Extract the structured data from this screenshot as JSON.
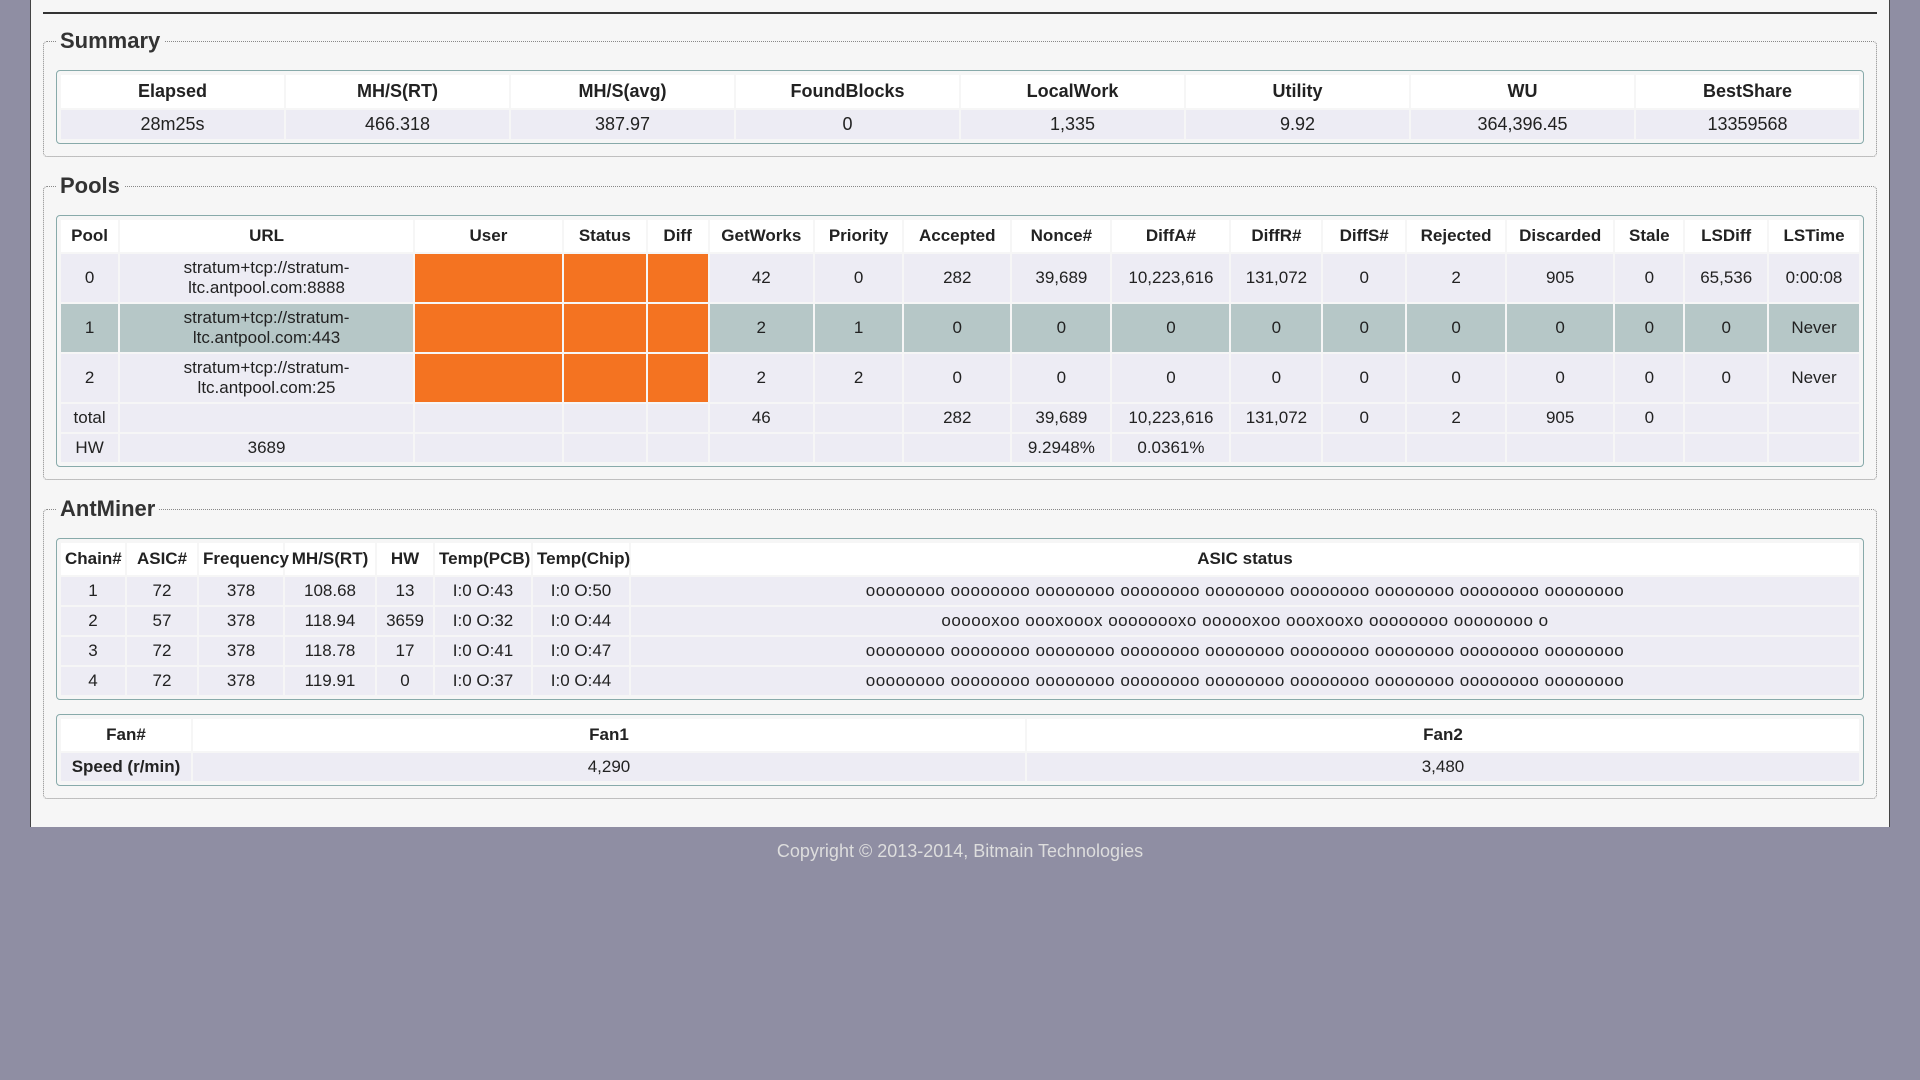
{
  "summary": {
    "legend": "Summary",
    "headers": [
      "Elapsed",
      "MH/S(RT)",
      "MH/S(avg)",
      "FoundBlocks",
      "LocalWork",
      "Utility",
      "WU",
      "BestShare"
    ],
    "row": [
      "28m25s",
      "466.318",
      "387.97",
      "0",
      "1,335",
      "9.92",
      "364,396.45",
      "13359568"
    ]
  },
  "pools": {
    "legend": "Pools",
    "headers": [
      "Pool",
      "URL",
      "User",
      "Status",
      "Diff",
      "GetWorks",
      "Priority",
      "Accepted",
      "Nonce#",
      "DiffA#",
      "DiffR#",
      "DiffS#",
      "Rejected",
      "Discarded",
      "Stale",
      "LSDiff",
      "LSTime"
    ],
    "rows": [
      {
        "highlight": false,
        "cells": [
          "0",
          "stratum+tcp://stratum-ltc.antpool.com:8888",
          "",
          "",
          "",
          "42",
          "0",
          "282",
          "39,689",
          "10,223,616",
          "131,072",
          "0",
          "2",
          "905",
          "0",
          "65,536",
          "0:00:08"
        ],
        "redact": [
          2,
          3,
          4
        ]
      },
      {
        "highlight": true,
        "cells": [
          "1",
          "stratum+tcp://stratum-ltc.antpool.com:443",
          "",
          "",
          "",
          "2",
          "1",
          "0",
          "0",
          "0",
          "0",
          "0",
          "0",
          "0",
          "0",
          "0",
          "Never"
        ],
        "redact": [
          2,
          3,
          4
        ]
      },
      {
        "highlight": false,
        "cells": [
          "2",
          "stratum+tcp://stratum-ltc.antpool.com:25",
          "",
          "",
          "",
          "2",
          "2",
          "0",
          "0",
          "0",
          "0",
          "0",
          "0",
          "0",
          "0",
          "0",
          "Never"
        ],
        "redact": [
          2,
          3,
          4
        ]
      },
      {
        "highlight": false,
        "cells": [
          "total",
          "",
          "",
          "",
          "",
          "46",
          "",
          "282",
          "39,689",
          "10,223,616",
          "131,072",
          "0",
          "2",
          "905",
          "0",
          "",
          ""
        ],
        "redact": []
      },
      {
        "highlight": false,
        "cells": [
          "HW",
          "3689",
          "",
          "",
          "",
          "",
          "",
          "",
          "9.2948%",
          "0.0361%",
          "",
          "",
          "",
          "",
          "",
          "",
          ""
        ],
        "redact": []
      }
    ]
  },
  "antminer": {
    "legend": "AntMiner",
    "headers": [
      "Chain#",
      "ASIC#",
      "Frequency",
      "MH/S(RT)",
      "HW",
      "Temp(PCB)",
      "Temp(Chip)",
      "ASIC status"
    ],
    "rows": [
      [
        "1",
        "72",
        "378",
        "108.68",
        "13",
        "I:0 O:43",
        "I:0 O:50",
        "oooooooo oooooooo oooooooo oooooooo oooooooo oooooooo oooooooo oooooooo oooooooo"
      ],
      [
        "2",
        "57",
        "378",
        "118.94",
        "3659",
        "I:0 O:32",
        "I:0 O:44",
        "oooooxoo oooxooox oooooooxo oooooxoo oooxooxo oooooooo oooooooo o"
      ],
      [
        "3",
        "72",
        "378",
        "118.78",
        "17",
        "I:0 O:41",
        "I:0 O:47",
        "oooooooo oooooooo oooooooo oooooooo oooooooo oooooooo oooooooo oooooooo oooooooo"
      ],
      [
        "4",
        "72",
        "378",
        "119.91",
        "0",
        "I:0 O:37",
        "I:0 O:44",
        "oooooooo oooooooo oooooooo oooooooo oooooooo oooooooo oooooooo oooooooo oooooooo"
      ]
    ],
    "fan_headers": [
      "Fan#",
      "Fan1",
      "Fan2"
    ],
    "fan_label": "Speed (r/min)",
    "fan_values": [
      "4,290",
      "3,480"
    ]
  },
  "footer": "Copyright © 2013-2014, Bitmain Technologies"
}
